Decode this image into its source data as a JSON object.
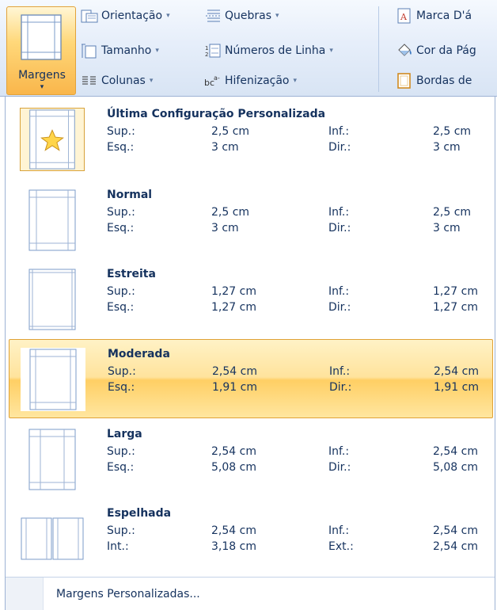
{
  "ribbon": {
    "margens_label": "Margens",
    "orientacao_label": "Orientação",
    "tamanho_label": "Tamanho",
    "colunas_label": "Colunas",
    "quebras_label": "Quebras",
    "numeros_linha_label": "Números de Linha",
    "hifenizacao_label": "Hifenização",
    "marca_dagua_label": "Marca D'á",
    "cor_pagina_label": "Cor da Pág",
    "bordas_label": "Bordas de",
    "caret": "▾"
  },
  "menu": {
    "options": [
      {
        "title": "Última Configuração Personalizada",
        "a_label": "Sup.:",
        "a_value": "2,5 cm",
        "b_label": "Inf.:",
        "b_value": "2,5 cm",
        "c_label": "Esq.:",
        "c_value": "3 cm",
        "d_label": "Dir.:",
        "d_value": "3 cm",
        "icon": "star-page-icon"
      },
      {
        "title": "Normal",
        "a_label": "Sup.:",
        "a_value": "2,5 cm",
        "b_label": "Inf.:",
        "b_value": "2,5 cm",
        "c_label": "Esq.:",
        "c_value": "3 cm",
        "d_label": "Dir.:",
        "d_value": "3 cm",
        "icon": "normal-margins-icon"
      },
      {
        "title": "Estreita",
        "a_label": "Sup.:",
        "a_value": "1,27 cm",
        "b_label": "Inf.:",
        "b_value": "1,27 cm",
        "c_label": "Esq.:",
        "c_value": "1,27 cm",
        "d_label": "Dir.:",
        "d_value": "1,27 cm",
        "icon": "narrow-margins-icon"
      },
      {
        "title": "Moderada",
        "a_label": "Sup.:",
        "a_value": "2,54 cm",
        "b_label": "Inf.:",
        "b_value": "2,54 cm",
        "c_label": "Esq.:",
        "c_value": "1,91 cm",
        "d_label": "Dir.:",
        "d_value": "1,91 cm",
        "icon": "moderate-margins-icon"
      },
      {
        "title": "Larga",
        "a_label": "Sup.:",
        "a_value": "2,54 cm",
        "b_label": "Inf.:",
        "b_value": "2,54 cm",
        "c_label": "Esq.:",
        "c_value": "5,08 cm",
        "d_label": "Dir.:",
        "d_value": "5,08 cm",
        "icon": "wide-margins-icon"
      },
      {
        "title": "Espelhada",
        "a_label": "Sup.:",
        "a_value": "2,54 cm",
        "b_label": "Inf.:",
        "b_value": "2,54 cm",
        "c_label": "Int.:",
        "c_value": "3,18 cm",
        "d_label": "Ext.:",
        "d_value": "2,54 cm",
        "icon": "mirrored-margins-icon"
      }
    ],
    "footer_label": "Margens Personalizadas..."
  },
  "colors": {
    "accent_orange": "#f9b64b",
    "highlight_yellow": "#ffe39c",
    "text_blue": "#15325e",
    "ribbon_blue": "#d8e4f4"
  }
}
